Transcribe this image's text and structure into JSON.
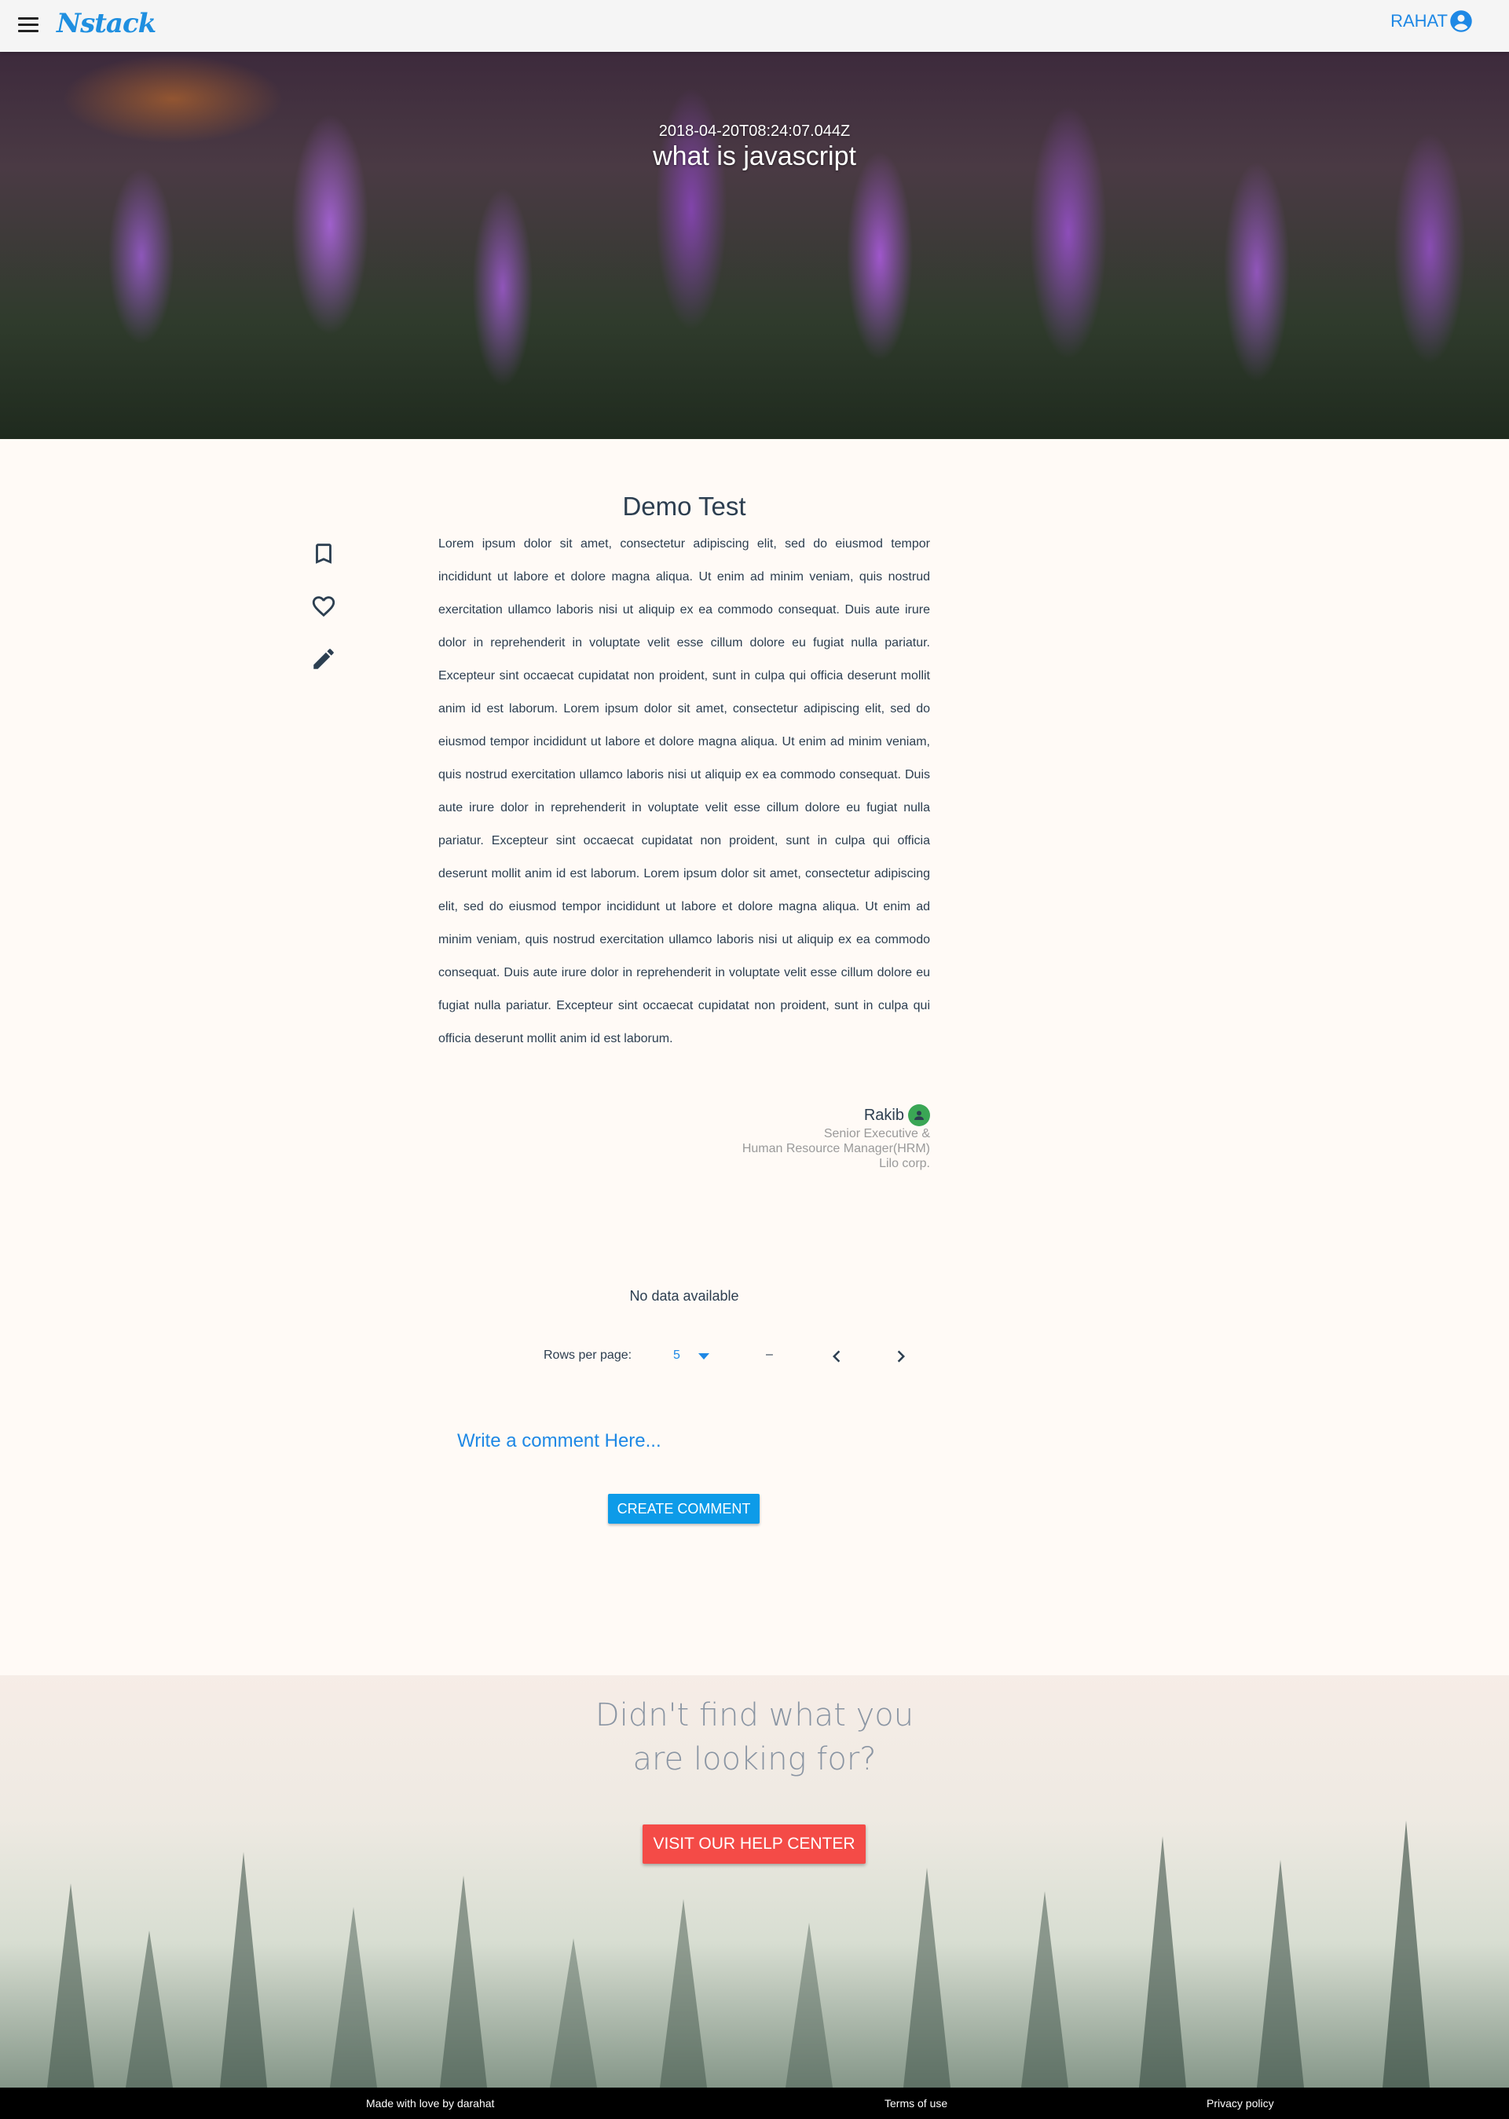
{
  "header": {
    "logo": "Nstack",
    "user_name": "RAHAT",
    "icons": {
      "menu": "menu-icon",
      "user": "account-circle-icon"
    }
  },
  "hero": {
    "date": "2018-04-20T08:24:07.044Z",
    "title": "what is javascript"
  },
  "side_actions": [
    {
      "name": "bookmark",
      "icon": "bookmark-icon"
    },
    {
      "name": "like",
      "icon": "heart-icon"
    },
    {
      "name": "edit",
      "icon": "pencil-icon"
    }
  ],
  "article": {
    "title": "Demo Test",
    "body": "Lorem ipsum dolor sit amet, consectetur adipiscing elit, sed do eiusmod tempor incididunt ut labore et dolore magna aliqua. Ut enim ad minim veniam, quis nostrud exercitation ullamco laboris nisi ut aliquip ex ea commodo consequat. Duis aute irure dolor in reprehenderit in voluptate velit esse cillum dolore eu fugiat nulla pariatur. Excepteur sint occaecat cupidatat non proident, sunt in culpa qui officia deserunt mollit anim id est laborum. Lorem ipsum dolor sit amet, consectetur adipiscing elit, sed do eiusmod tempor incididunt ut labore et dolore magna aliqua. Ut enim ad minim veniam, quis nostrud exercitation ullamco laboris nisi ut aliquip ex ea commodo consequat. Duis aute irure dolor in reprehenderit in voluptate velit esse cillum dolore eu fugiat nulla pariatur. Excepteur sint occaecat cupidatat non proident, sunt in culpa qui officia deserunt mollit anim id est laborum. Lorem ipsum dolor sit amet, consectetur adipiscing elit, sed do eiusmod tempor incididunt ut labore et dolore magna aliqua. Ut enim ad minim veniam, quis nostrud exercitation ullamco laboris nisi ut aliquip ex ea commodo consequat. Duis aute irure dolor in reprehenderit in voluptate velit esse cillum dolore eu fugiat nulla pariatur. Excepteur sint occaecat cupidatat non proident, sunt in culpa qui officia deserunt mollit anim id est laborum."
  },
  "author": {
    "name": "Rakib",
    "line1": "Senior Executive &",
    "line2": "Human Resource Manager(HRM)",
    "line3": "Lilo corp.",
    "avatar_color": "#3aa655"
  },
  "comments_table": {
    "empty_text": "No data available",
    "rows_per_page_label": "Rows per page:",
    "rows_per_page_value": "5",
    "range_text": "–",
    "icons": {
      "prev": "chevron-left-icon",
      "next": "chevron-right-icon",
      "dropdown": "caret-down-icon"
    }
  },
  "comment_form": {
    "placeholder": "Write a comment Here...",
    "submit_label": "CREATE COMMENT"
  },
  "help": {
    "title_line1": "Didn't find what you",
    "title_line2": "are looking for?",
    "button_label": "VISIT OUR HELP CENTER"
  },
  "footer": {
    "made_with": "Made with love by darahat",
    "terms": "Terms of use",
    "privacy": "Privacy policy"
  },
  "colors": {
    "accent": "#1e88e5",
    "primary_button": "#0d9be8",
    "help_button": "#f44b47",
    "page_background": "#fffaf6"
  }
}
